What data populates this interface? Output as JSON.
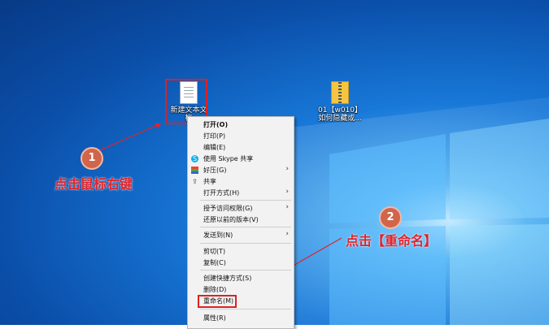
{
  "desktop": {
    "icon1": {
      "label": "新建文本文\n档"
    },
    "icon2": {
      "label": "01【w010】\n如何隐藏或..."
    }
  },
  "menu": {
    "items": [
      {
        "label": "打开(O)"
      },
      {
        "label": "打印(P)"
      },
      {
        "label": "编辑(E)"
      },
      {
        "label": "使用 Skype 共享"
      },
      {
        "label": "好压(G)"
      },
      {
        "label": "共享"
      },
      {
        "label": "打开方式(H)"
      },
      {
        "label": "授予访问权限(G)"
      },
      {
        "label": "还原以前的版本(V)"
      },
      {
        "label": "发送到(N)"
      },
      {
        "label": "剪切(T)"
      },
      {
        "label": "复制(C)"
      },
      {
        "label": "创建快捷方式(S)"
      },
      {
        "label": "删除(D)"
      },
      {
        "label": "重命名(M)"
      },
      {
        "label": "属性(R)"
      }
    ]
  },
  "annotations": {
    "step1": {
      "number": "1",
      "text": "点击鼠标右键"
    },
    "step2": {
      "number": "2",
      "text": "点击【重命名】"
    }
  },
  "colors": {
    "annotation": "#e0232a",
    "badge": "#d0654a",
    "menu_bg": "#f2f2f2"
  },
  "icons": [
    "text-document-icon",
    "archive-icon",
    "skype-icon",
    "haozip-icon",
    "share-icon",
    "submenu-arrow-icon"
  ]
}
